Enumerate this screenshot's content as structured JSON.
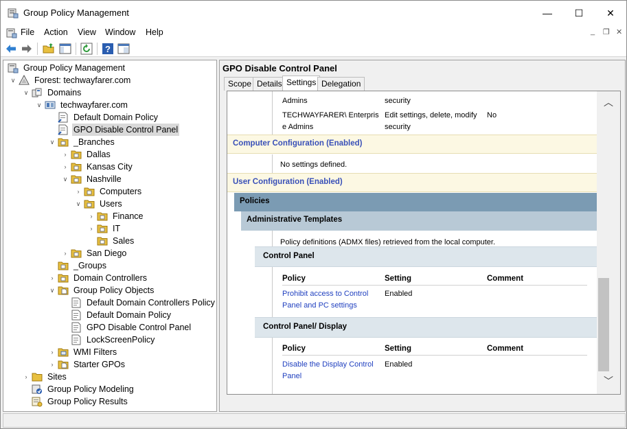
{
  "window": {
    "title": "Group Policy Management",
    "controls": {
      "minimize": "—",
      "maximize": "☐",
      "close": "✕"
    }
  },
  "menu": {
    "items": [
      "File",
      "Action",
      "View",
      "Window",
      "Help"
    ],
    "mdi": {
      "minimize": "_",
      "restore": "❐",
      "close": "✕"
    }
  },
  "toolbar": {
    "icons": [
      "back-arrow-icon",
      "forward-arrow-icon",
      "up-folder-icon",
      "show-hide-tree-icon",
      "refresh-icon",
      "help-icon",
      "properties-icon"
    ]
  },
  "tree": {
    "root": "Group Policy Management",
    "forest": "Forest: techwayfarer.com",
    "domains": "Domains",
    "domain": "techwayfarer.com",
    "default_domain_policy": "Default Domain Policy",
    "gpo_disable_cp": "GPO Disable Control Panel",
    "branches": "_Branches",
    "dallas": "Dallas",
    "kansas_city": "Kansas City",
    "nashville": "Nashville",
    "computers": "Computers",
    "users": "Users",
    "finance": "Finance",
    "it": "IT",
    "sales": "Sales",
    "san_diego": "San Diego",
    "groups": "_Groups",
    "domain_controllers": "Domain Controllers",
    "gpo_objects": "Group Policy Objects",
    "gpo_ddcp": "Default Domain Controllers Policy",
    "gpo_ddp": "Default Domain Policy",
    "gpo_dcp": "GPO Disable Control Panel",
    "gpo_lock": "LockScreenPolicy",
    "wmi_filters": "WMI Filters",
    "starter_gpos": "Starter GPOs",
    "sites": "Sites",
    "modeling": "Group Policy Modeling",
    "results": "Group Policy Results"
  },
  "right": {
    "title": "GPO Disable Control Panel",
    "tabs": [
      "Scope",
      "Details",
      "Settings",
      "Delegation"
    ],
    "active_tab": "Settings"
  },
  "report": {
    "deleg_row1": {
      "name": "Admins",
      "perm": "security"
    },
    "deleg_row2": {
      "name_l1": "TECHWAYFARER\\ Enterpris",
      "name_l2": "e Admins",
      "perm_l1": "Edit settings, delete, modify",
      "perm_l2": "security",
      "inherited": "No"
    },
    "computer_config": "Computer Configuration (Enabled)",
    "no_settings": "No settings defined.",
    "user_config": "User Configuration (Enabled)",
    "policies": "Policies",
    "admin_templates": "Administrative Templates",
    "admx_note": "Policy definitions (ADMX files) retrieved from the local computer.",
    "cp_section": "Control Panel",
    "cpd_section": "Control Panel/ Display",
    "col_policy": "Policy",
    "col_setting": "Setting",
    "col_comment": "Comment",
    "cp_row": {
      "policy_l1": "Prohibit access to Control",
      "policy_l2": "Panel and PC settings",
      "setting": "Enabled"
    },
    "cpd_row": {
      "policy_l1": "Disable the Display Control",
      "policy_l2": "Panel",
      "setting": "Enabled"
    }
  },
  "scrollbar": {
    "up": "︿",
    "down": "﹀"
  }
}
